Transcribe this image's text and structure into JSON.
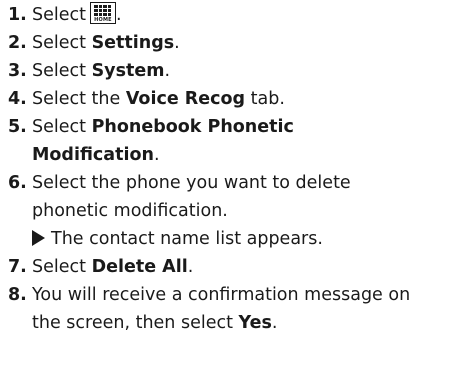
{
  "steps": [
    {
      "num": "1.",
      "pre": "Select",
      "post": "."
    },
    {
      "num": "2.",
      "pre": "Select ",
      "bold": "Settings",
      "post": "."
    },
    {
      "num": "3.",
      "pre": "Select ",
      "bold": "System",
      "post": "."
    },
    {
      "num": "4.",
      "pre": "Select the ",
      "bold": "Voice Recog",
      "post": " tab."
    },
    {
      "num": "5.",
      "pre": "Select ",
      "bold": "Phonebook Phonetic",
      "bold2": "Modification",
      "post": "."
    },
    {
      "num": "6.",
      "pre": "Select the phone you want to delete",
      "line2": "phonetic modification."
    },
    {
      "num": "7.",
      "pre": "Select ",
      "bold": "Delete All",
      "post": "."
    },
    {
      "num": "8.",
      "pre": "You will receive a confirmation message on",
      "line2": "the screen, then select ",
      "bold": "Yes",
      "post": "."
    }
  ],
  "result_text": "The contact name list appears.",
  "home_icon": {
    "name": "home-menu-icon",
    "label": "HOME"
  }
}
